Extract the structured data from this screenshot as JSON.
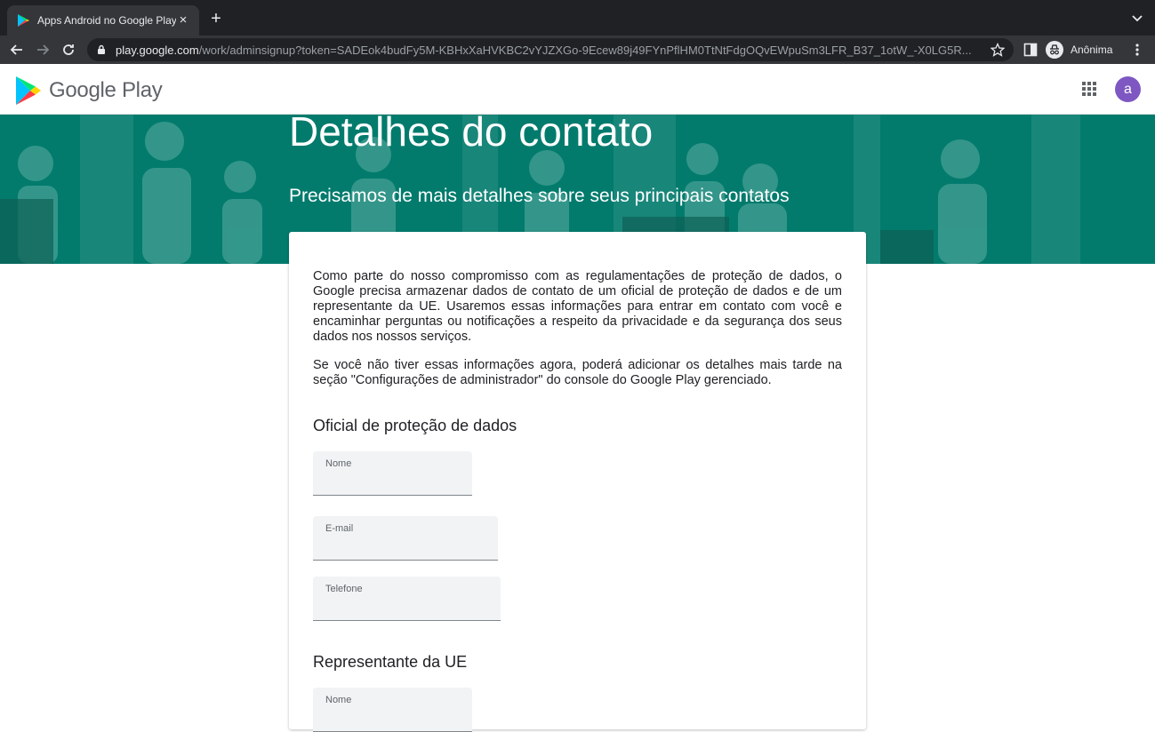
{
  "browser": {
    "tab_title": "Apps Android no Google Play",
    "url_host": "play.google.com",
    "url_path": "/work/adminsignup?token=SADEok4budFy5M-KBHxXaHVKBC2vYJZXGo-9Ecew89j49FYnPflHM0TtNtFdgOQvEWpuSm3LFR_B37_1otW_-X0LG5R...",
    "incognito_label": "Anônima"
  },
  "header": {
    "wordmark": "Google Play",
    "avatar_letter": "a"
  },
  "hero": {
    "title": "Detalhes do contato",
    "subtitle": "Precisamos de mais detalhes sobre seus principais contatos"
  },
  "card": {
    "paragraph1": "Como parte do nosso compromisso com as regulamentações de proteção de dados, o Google precisa armazenar dados de contato de um oficial de proteção de dados e de um representante da UE. Usaremos essas informações para entrar em contato com você e encaminhar perguntas ou notificações a respeito da privacidade e da segurança dos seus dados nos nossos serviços.",
    "paragraph2": "Se você não tiver essas informações agora, poderá adicionar os detalhes mais tarde na seção \"Configurações de administrador\" do console do Google Play gerenciado.",
    "dpo": {
      "title": "Oficial de proteção de dados",
      "name_label": "Nome",
      "email_label": "E-mail",
      "phone_label": "Telefone"
    },
    "eu_rep": {
      "title": "Representante da UE",
      "name_label": "Nome"
    }
  },
  "colors": {
    "hero_bg": "#027b6d",
    "avatar_bg": "#7e57c2",
    "field_bg": "#f1f3f4"
  }
}
